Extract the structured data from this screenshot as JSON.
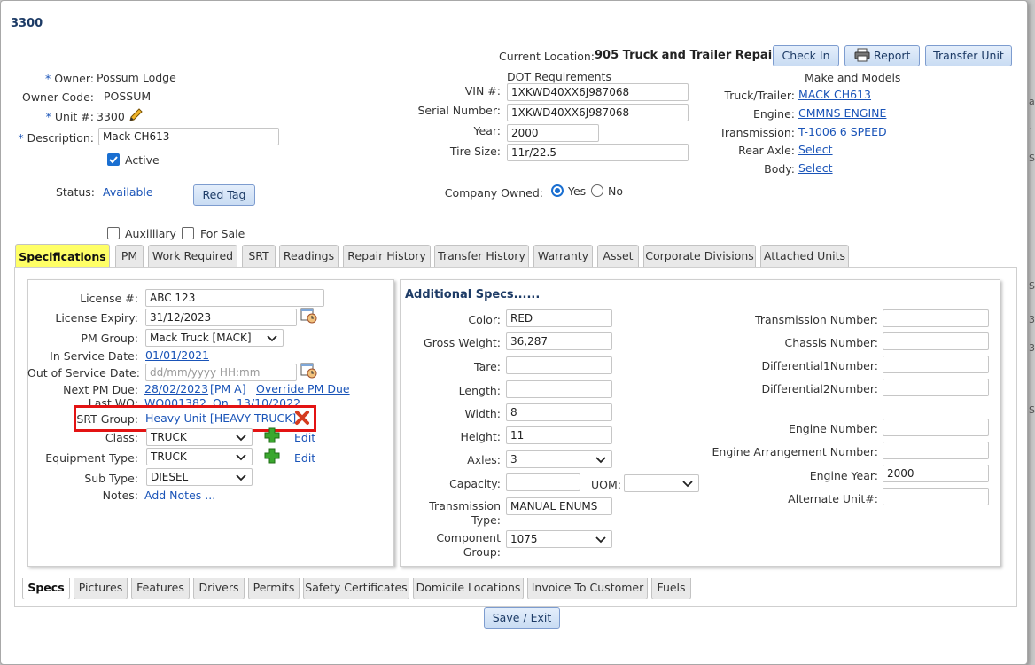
{
  "dialog": {
    "title": "3300"
  },
  "header": {
    "current_location_label": "Current Location:",
    "current_location_value": "905 Truck and Trailer Repair",
    "check_in_label": "Check In",
    "report_label": "Report",
    "transfer_unit_label": "Transfer Unit"
  },
  "owner": {
    "owner_label": "Owner:",
    "owner_value": "Possum Lodge",
    "owner_code_label": "Owner Code:",
    "owner_code_value": "POSSUM",
    "unit_label": "Unit #:",
    "unit_value": "3300",
    "description_label": "Description:",
    "description_value": "Mack CH613",
    "active_label": "Active",
    "status_label": "Status:",
    "status_value": "Available",
    "red_tag_label": "Red Tag",
    "auxiliary_label": "Auxilliary",
    "for_sale_label": "For Sale",
    "required_marker": "*"
  },
  "dot": {
    "title": "DOT Requirements",
    "vin_label": "VIN #:",
    "vin_value": "1XKWD40XX6J987068",
    "serial_label": "Serial Number:",
    "serial_value": "1XKWD40XX6J987068",
    "year_label": "Year:",
    "year_value": "2000",
    "tire_label": "Tire Size:",
    "tire_value": "11r/22.5",
    "company_owned_label": "Company Owned:",
    "yes_label": "Yes",
    "no_label": "No"
  },
  "make": {
    "title": "Make and Models",
    "truck_label": "Truck/Trailer:",
    "truck_value": "MACK CH613",
    "engine_label": "Engine:",
    "engine_value": "CMMNS ENGINE",
    "transmission_label": "Transmission:",
    "transmission_value": "T-1006 6 SPEED",
    "rear_axle_label": "Rear Axle:",
    "rear_axle_value": "Select",
    "body_label": "Body:",
    "body_value": "Select"
  },
  "tabs": [
    "Specifications",
    "PM",
    "Work Required",
    "SRT",
    "Readings",
    "Repair History",
    "Transfer History",
    "Warranty",
    "Asset",
    "Corporate Divisions",
    "Attached Units"
  ],
  "specs": {
    "license_label": "License #:",
    "license_value": "ABC 123",
    "license_expiry_label": "License Expiry:",
    "license_expiry_value": "31/12/2023",
    "pm_group_label": "PM Group:",
    "pm_group_value": "Mack Truck [MACK]",
    "in_service_label": "In Service Date:",
    "in_service_value": "01/01/2021",
    "out_service_label": "Out of Service Date:",
    "out_service_placeholder": "dd/mm/yyyy HH:mm",
    "next_pm_label": "Next PM Due:",
    "next_pm_value": "28/02/2023",
    "next_pm_tag": "[PM A]",
    "override_label": "Override PM Due",
    "last_wo_label": "Last WO:",
    "last_wo_value": "WO001382",
    "last_wo_on": "On",
    "last_wo_date": "13/10/2022",
    "srt_group_label": "SRT Group:",
    "srt_group_value": "Heavy Unit [HEAVY TRUCK]",
    "class_label": "Class:",
    "class_value": "TRUCK",
    "equipment_type_label": "Equipment Type:",
    "equipment_type_value": "TRUCK",
    "sub_type_label": "Sub Type:",
    "sub_type_value": "DIESEL",
    "notes_label": "Notes:",
    "notes_value": "Add Notes ...",
    "edit_label": "Edit"
  },
  "additional": {
    "title": "Additional Specs......",
    "color_label": "Color:",
    "color_value": "RED",
    "gross_weight_label": "Gross Weight:",
    "gross_weight_value": "36,287",
    "tare_label": "Tare:",
    "tare_value": "",
    "length_label": "Length:",
    "length_value": "",
    "width_label": "Width:",
    "width_value": "8",
    "height_label": "Height:",
    "height_value": "11",
    "axles_label": "Axles:",
    "axles_value": "3",
    "capacity_label": "Capacity:",
    "capacity_value": "",
    "uom_label": "UOM:",
    "uom_value": "",
    "transmission_type_label_1": "Transmission",
    "transmission_type_label_2": "Type:",
    "transmission_type_value": "MANUAL ENUMS",
    "component_group_label_1": "Component",
    "component_group_label_2": "Group:",
    "component_group_value": "1075",
    "transmission_number_label": "Transmission Number:",
    "chassis_number_label": "Chassis Number:",
    "diff1_label": "Differential1Number:",
    "diff2_label": "Differential2Number:",
    "engine_number_label": "Engine Number:",
    "engine_arrangement_label": "Engine Arrangement Number:",
    "engine_year_label": "Engine Year:",
    "engine_year_value": "2000",
    "alternate_unit_label": "Alternate Unit#:"
  },
  "bottom_tabs": [
    "Specs",
    "Pictures",
    "Features",
    "Drivers",
    "Permits",
    "Safety Certificates",
    "Domicile Locations",
    "Invoice To Customer",
    "Fuels"
  ],
  "footer": {
    "save_exit_label": "Save / Exit"
  },
  "colors": {
    "accent": "#1a54b8",
    "active_tab": "#ffff66",
    "highlight": "#e31313",
    "title": "#1d3b66"
  }
}
